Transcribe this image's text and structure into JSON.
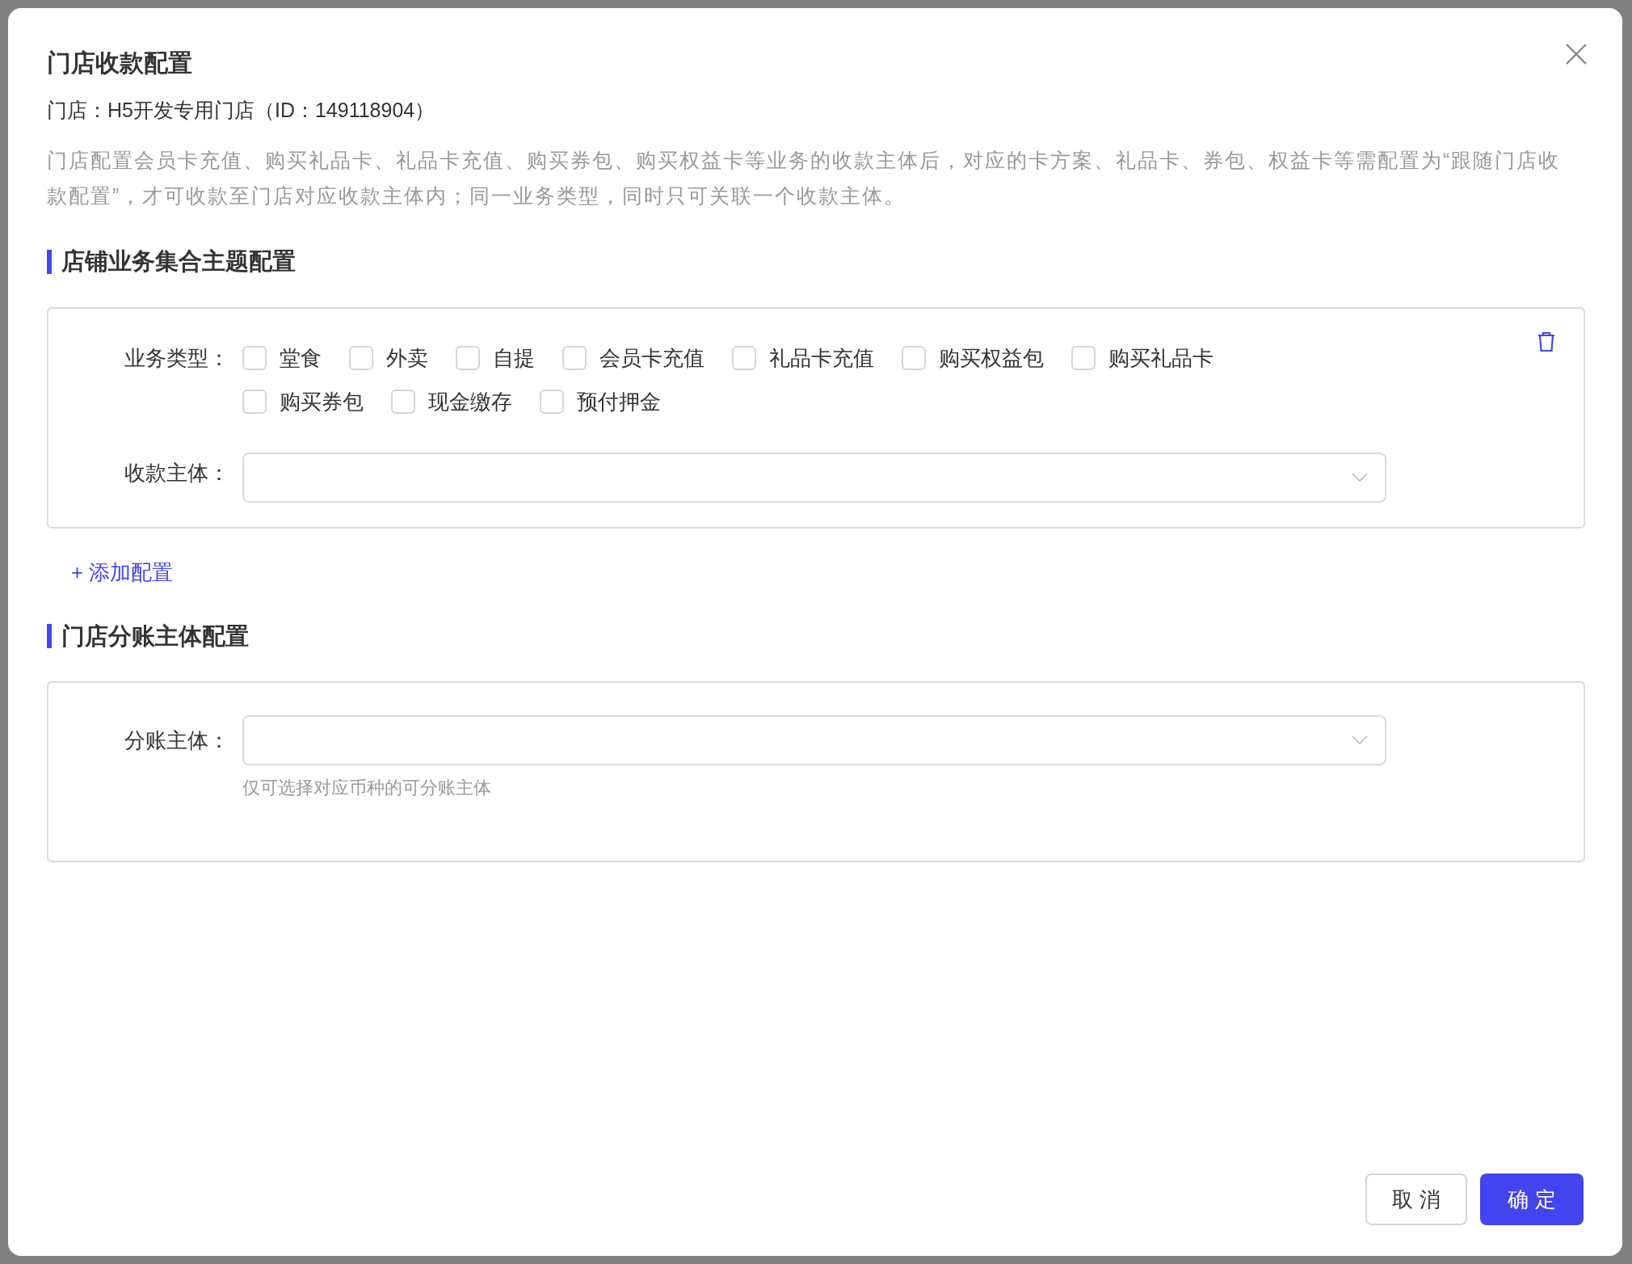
{
  "dialog": {
    "title": "门店收款配置",
    "store_line": "门店：H5开发专用门店（ID：149118904）",
    "description": "门店配置会员卡充值、购买礼品卡、礼品卡充值、购买券包、购买权益卡等业务的收款主体后，对应的卡方案、礼品卡、券包、权益卡等需配置为“跟随门店收款配置”，才可收款至门店对应收款主体内；同一业务类型，同时只可关联一个收款主体。"
  },
  "sections": [
    {
      "title": "店铺业务集合主题配置",
      "cards": [
        {
          "business_type_label": "业务类型：",
          "business_types": [
            {
              "label": "堂食",
              "checked": false
            },
            {
              "label": "外卖",
              "checked": false
            },
            {
              "label": "自提",
              "checked": false
            },
            {
              "label": "会员卡充值",
              "checked": false
            },
            {
              "label": "礼品卡充值",
              "checked": false
            },
            {
              "label": "购买权益包",
              "checked": false
            },
            {
              "label": "购买礼品卡",
              "checked": false
            },
            {
              "label": "购买券包",
              "checked": false
            },
            {
              "label": "现金缴存",
              "checked": false
            },
            {
              "label": "预付押金",
              "checked": false
            }
          ],
          "payee_label": "收款主体："
        }
      ],
      "add_link": "+ 添加配置"
    },
    {
      "title": "门店分账主体配置",
      "split_label": "分账主体：",
      "split_hint": "仅可选择对应币种的可分账主体"
    }
  ],
  "buttons": [
    {
      "label": "取 消",
      "kind": "secondary"
    },
    {
      "label": "确 定",
      "kind": "primary"
    }
  ]
}
